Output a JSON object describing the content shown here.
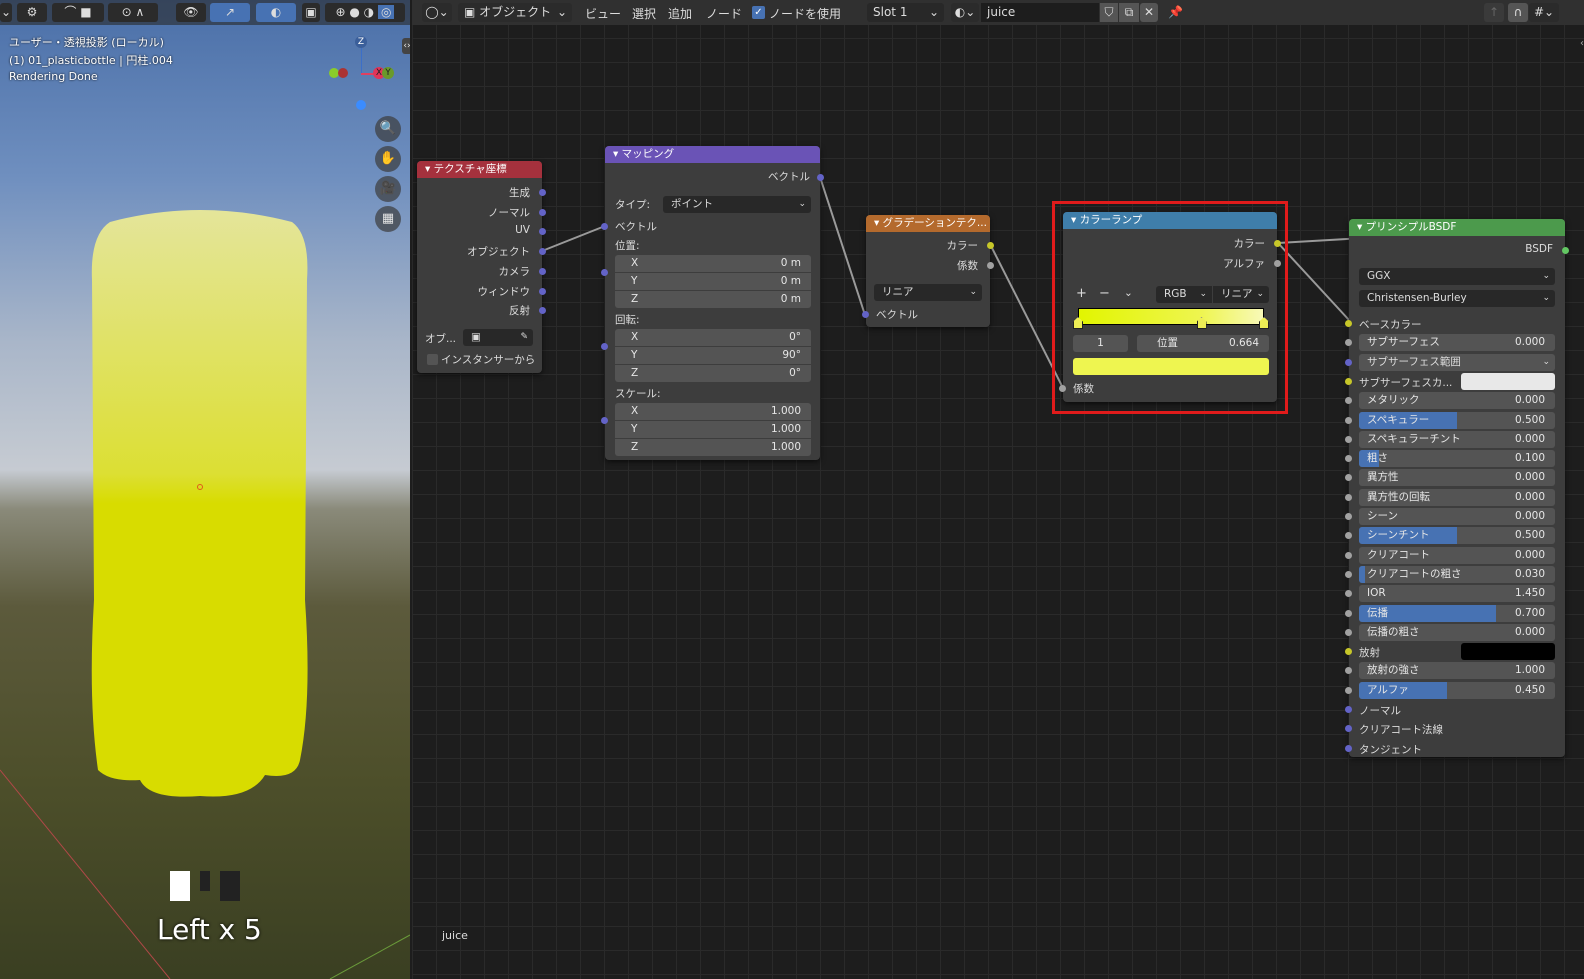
{
  "viewport": {
    "view_name": "ユーザー・透視投影 (ローカル)",
    "object_info": "(1) 01_plasticbottle | 円柱.004",
    "status": "Rendering Done",
    "gizmo": {
      "z": "Z",
      "x": "X",
      "y": "Y"
    },
    "key_overlay": "Left x 5"
  },
  "node_editor": {
    "toolbar": {
      "mode": "オブジェクト",
      "menus": [
        "ビュー",
        "選択",
        "追加",
        "ノード"
      ],
      "use_nodes_label": "ノードを使用",
      "use_nodes": true,
      "slot": "Slot 1",
      "material": "juice"
    },
    "footer_label": "juice",
    "nodes": {
      "tex_coord": {
        "title": "テクスチャ座標",
        "outputs": [
          "生成",
          "ノーマル",
          "UV",
          "オブジェクト",
          "カメラ",
          "ウィンドウ",
          "反射"
        ],
        "object_label": "オブ...",
        "instancer_label": "インスタンサーから",
        "instancer": false,
        "color": "#a5313d"
      },
      "mapping": {
        "title": "マッピング",
        "output": "ベクトル",
        "type_label": "タイプ:",
        "type_value": "ポイント",
        "vector_input": "ベクトル",
        "location_label": "位置:",
        "location": [
          {
            "axis": "X",
            "value": "0 m"
          },
          {
            "axis": "Y",
            "value": "0 m"
          },
          {
            "axis": "Z",
            "value": "0 m"
          }
        ],
        "rotation_label": "回転:",
        "rotation": [
          {
            "axis": "X",
            "value": "0°"
          },
          {
            "axis": "Y",
            "value": "90°"
          },
          {
            "axis": "Z",
            "value": "0°"
          }
        ],
        "scale_label": "スケール:",
        "scale": [
          {
            "axis": "X",
            "value": "1.000"
          },
          {
            "axis": "Y",
            "value": "1.000"
          },
          {
            "axis": "Z",
            "value": "1.000"
          }
        ],
        "color": "#6a53b6"
      },
      "gradient": {
        "title": "グラデーションテク...",
        "outputs": [
          "カラー",
          "係数"
        ],
        "type_value": "リニア",
        "input": "ベクトル",
        "color": "#b46a2d"
      },
      "color_ramp": {
        "title": "カラーランプ",
        "outputs": [
          "カラー",
          "アルファ"
        ],
        "plus": "+",
        "minus": "−",
        "color_mode": "RGB",
        "interpolation": "リニア",
        "active_index": "1",
        "position_label": "位置",
        "position": "0.664",
        "input": "係数",
        "stops": [
          0,
          0.664,
          1
        ],
        "selected_color": "#eef550",
        "color": "#3f7eaa",
        "highlight": "#e01b1b"
      },
      "principled": {
        "title": "プリンシプルBSDF",
        "output": "BSDF",
        "distribution": "GGX",
        "subsurface_method": "Christensen-Burley",
        "color": "#4c9a4c",
        "inputs": [
          {
            "label": "ベースカラー",
            "type": "link",
            "sock": "yel"
          },
          {
            "label": "サブサーフェス",
            "value": "0.000",
            "sock": "gray"
          },
          {
            "label": "サブサーフェス範囲",
            "type": "select",
            "sock": "blue"
          },
          {
            "label": "サブサーフェスカ...",
            "type": "color",
            "swatch": "#e8e8e8",
            "sock": "yel"
          },
          {
            "label": "メタリック",
            "value": "0.000",
            "sock": "gray"
          },
          {
            "label": "スペキュラー",
            "value": "0.500",
            "fill": 0.5,
            "sock": "gray"
          },
          {
            "label": "スペキュラーチント",
            "value": "0.000",
            "sock": "gray"
          },
          {
            "label": "粗さ",
            "value": "0.100",
            "fill": 0.1,
            "sock": "gray"
          },
          {
            "label": "異方性",
            "value": "0.000",
            "sock": "gray"
          },
          {
            "label": "異方性の回転",
            "value": "0.000",
            "sock": "gray"
          },
          {
            "label": "シーン",
            "value": "0.000",
            "sock": "gray"
          },
          {
            "label": "シーンチント",
            "value": "0.500",
            "fill": 0.5,
            "sock": "gray"
          },
          {
            "label": "クリアコート",
            "value": "0.000",
            "sock": "gray"
          },
          {
            "label": "クリアコートの粗さ",
            "value": "0.030",
            "fill": 0.03,
            "sock": "gray"
          },
          {
            "label": "IOR",
            "value": "1.450",
            "sock": "gray"
          },
          {
            "label": "伝播",
            "value": "0.700",
            "fill": 0.7,
            "sock": "gray"
          },
          {
            "label": "伝播の粗さ",
            "value": "0.000",
            "sock": "gray"
          },
          {
            "label": "放射",
            "type": "color",
            "swatch": "#000000",
            "sock": "yel"
          },
          {
            "label": "放射の強さ",
            "value": "1.000",
            "sock": "gray"
          },
          {
            "label": "アルファ",
            "value": "0.450",
            "fill": 0.45,
            "sock": "gray"
          },
          {
            "label": "ノーマル",
            "type": "link",
            "sock": "blue"
          },
          {
            "label": "クリアコート法線",
            "type": "link",
            "sock": "blue"
          },
          {
            "label": "タンジェント",
            "type": "link",
            "sock": "blue"
          }
        ]
      }
    }
  }
}
